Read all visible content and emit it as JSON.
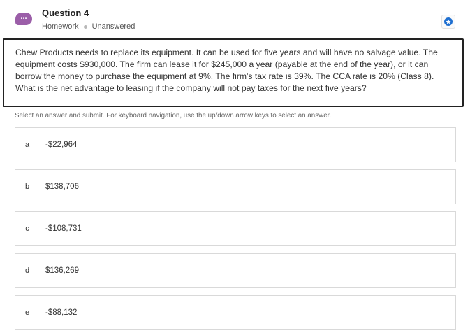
{
  "header": {
    "menu_icon_glyph": "...",
    "title": "Question 4",
    "category": "Homework",
    "status": "Unanswered",
    "bookmark_icon": "star-icon",
    "accent_color": "#1e6fd0",
    "badge_color": "#9b5ea8"
  },
  "question": {
    "text": "Chew Products needs to replace its equipment. It can be used for five years and will have no salvage value. The equipment costs $930,000. The firm can lease it for $245,000 a year (payable at the end of the year), or it can borrow the money to purchase the equipment at 9%. The firm's tax rate is 39%. The CCA rate is 20% (Class 8). What is the net advantage to leasing if the company will not pay taxes for the next five years?"
  },
  "instruction": "Select an answer and submit. For keyboard navigation, use the up/down arrow keys to select an answer.",
  "options": [
    {
      "letter": "a",
      "value": "-$22,964"
    },
    {
      "letter": "b",
      "value": "$138,706"
    },
    {
      "letter": "c",
      "value": "-$108,731"
    },
    {
      "letter": "d",
      "value": "$136,269"
    },
    {
      "letter": "e",
      "value": "-$88,132"
    }
  ]
}
